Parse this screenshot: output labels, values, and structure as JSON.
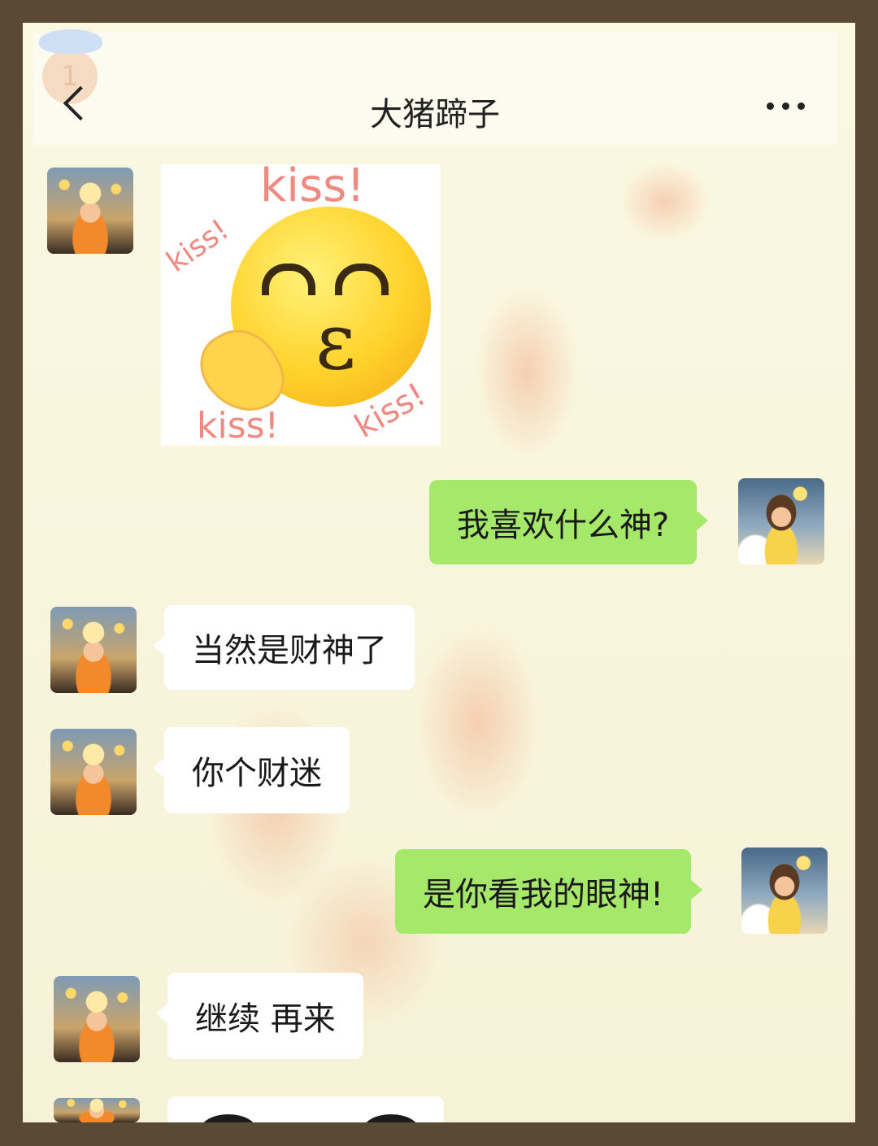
{
  "header": {
    "title": "大猪蹄子",
    "badge_count": "1",
    "back_icon": "chevron-left-icon",
    "more_icon": "more-horizontal-icon"
  },
  "messages": [
    {
      "side": "in",
      "type": "sticker",
      "sticker_texts": [
        "kiss!",
        "kiss!",
        "kiss!",
        "kiss!"
      ]
    },
    {
      "side": "out",
      "type": "text",
      "text": "我喜欢什么神?"
    },
    {
      "side": "in",
      "type": "text",
      "text": "当然是财神了"
    },
    {
      "side": "in",
      "type": "text",
      "text": "你个财迷"
    },
    {
      "side": "out",
      "type": "text",
      "text": "是你看我的眼神!"
    },
    {
      "side": "in",
      "type": "text",
      "text": "继续 再来"
    }
  ],
  "colors": {
    "outgoing_bubble": "#a5e86a",
    "incoming_bubble": "#ffffff",
    "frame": "#5a4a35"
  }
}
